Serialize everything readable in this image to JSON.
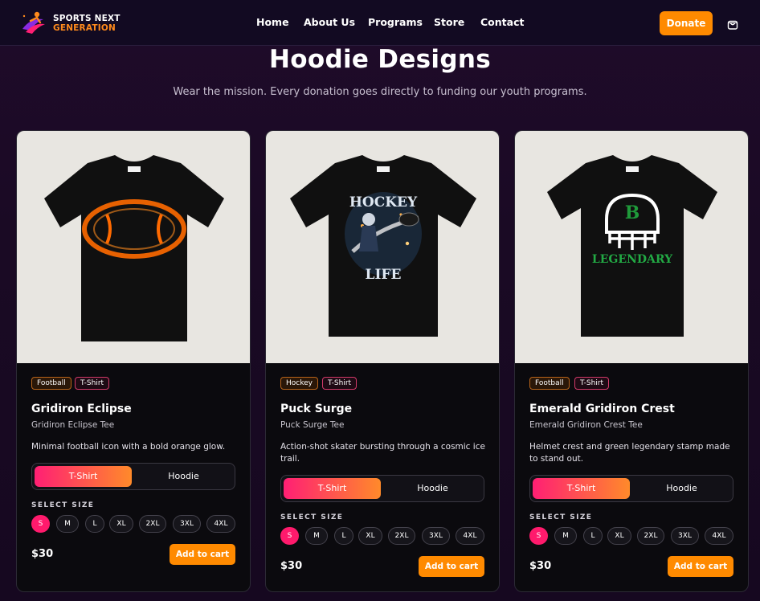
{
  "nav": {
    "logo_line1": "SPORTS NEXT",
    "logo_line2": "GENERATION",
    "links": [
      "Home",
      "About Us",
      "Programs",
      "Store",
      "Contact"
    ],
    "donate_label": "Donate",
    "icons": {
      "logo": "sports-figure-logo",
      "cart": "shopping-bag-icon"
    },
    "colors": {
      "accent": "#ff8a00",
      "brand_orange": "#ff8a1c",
      "background": "#120a22"
    }
  },
  "hero": {
    "title": "Hoodie Designs",
    "subtitle": "Wear the mission. Every donation goes directly to funding our youth programs."
  },
  "size_label": "SELECT SIZE",
  "sizes": [
    "S",
    "M",
    "L",
    "XL",
    "2XL",
    "3XL",
    "4XL"
  ],
  "products": [
    {
      "tags": [
        "Football",
        "T-Shirt"
      ],
      "name": "Gridiron Eclipse",
      "subtitle": "Gridiron Eclipse Tee",
      "description": "Minimal football icon with a bold orange glow.",
      "type_options": [
        "T-Shirt",
        "Hoodie"
      ],
      "selected_type": "T-Shirt",
      "selected_size": "S",
      "price": "$30",
      "cart_label": "Add to cart"
    },
    {
      "tags": [
        "Hockey",
        "T-Shirt"
      ],
      "name": "Puck Surge",
      "subtitle": "Puck Surge Tee",
      "description": "Action-shot skater bursting through a cosmic ice trail.",
      "graphic_text": [
        "HOCKEY",
        "LIFE"
      ],
      "type_options": [
        "T-Shirt",
        "Hoodie"
      ],
      "selected_type": "T-Shirt",
      "selected_size": "S",
      "price": "$30",
      "cart_label": "Add to cart"
    },
    {
      "tags": [
        "Football",
        "T-Shirt"
      ],
      "name": "Emerald Gridiron Crest",
      "subtitle": "Emerald Gridiron Crest Tee",
      "description": "Helmet crest and green legendary stamp made to stand out.",
      "graphic_text": [
        "B",
        "LEGENDARY"
      ],
      "type_options": [
        "T-Shirt",
        "Hoodie"
      ],
      "selected_type": "T-Shirt",
      "selected_size": "S",
      "price": "$30",
      "cart_label": "Add to cart"
    }
  ]
}
